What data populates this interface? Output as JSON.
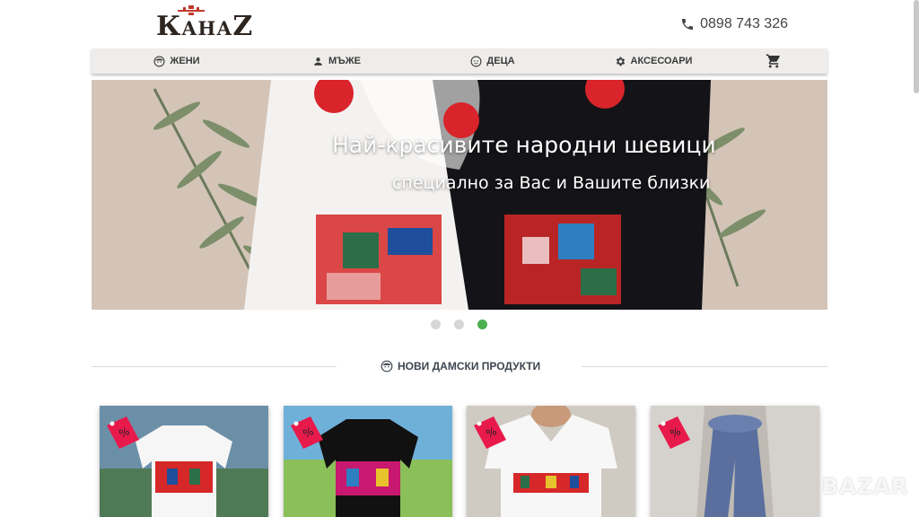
{
  "header": {
    "logo_text": "КанаZ",
    "phone": "0898 743 326"
  },
  "nav": {
    "items": [
      {
        "label": "ЖЕНИ",
        "icon": "woman-face-icon"
      },
      {
        "label": "МЪЖЕ",
        "icon": "person-icon"
      },
      {
        "label": "ДЕЦА",
        "icon": "child-face-icon"
      },
      {
        "label": "АКСЕСОАРИ",
        "icon": "gear-icon"
      }
    ],
    "cart_icon": "cart-icon"
  },
  "hero": {
    "title": "Най-красивите народни шевици",
    "subtitle": "специално за Вас и Вашите близки",
    "slides": 3,
    "active_slide": 3
  },
  "section": {
    "title": "НОВИ ДАМСКИ ПРОДУКТИ",
    "icon": "woman-face-icon"
  },
  "products": [
    {
      "badge": "%",
      "color": "white t-shirt"
    },
    {
      "badge": "%",
      "color": "black t-shirt"
    },
    {
      "badge": "%",
      "color": "white v-neck t-shirt"
    },
    {
      "badge": "%",
      "color": "blue scarf"
    }
  ],
  "watermark": "BAZAR",
  "colors": {
    "accent": "#4caf50",
    "tag": "#e8194b",
    "nav_bg": "#efedeb"
  }
}
